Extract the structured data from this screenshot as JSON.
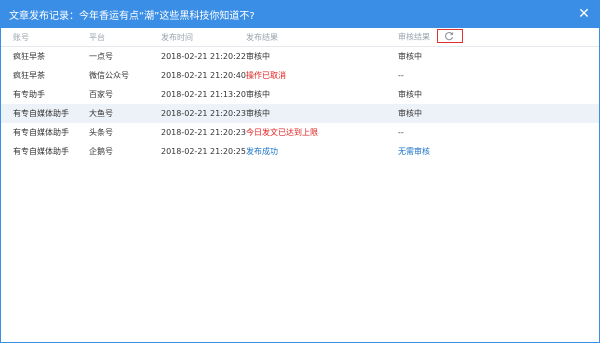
{
  "dialog": {
    "title": "文章发布记录：今年香运有点“潮”这些黑科技你知道不?"
  },
  "table": {
    "headers": [
      "账号",
      "平台",
      "发布时间",
      "发布结果",
      "审核结果"
    ],
    "rows": [
      {
        "account": "疯狂早茶",
        "platform": "一点号",
        "time": "2018-02-21 21:20:22",
        "result": "审核中",
        "review": "审核中"
      },
      {
        "account": "疯狂早茶",
        "platform": "微信公众号",
        "time": "2018-02-21 21:20:40",
        "result": "操作已取消",
        "review": "--"
      },
      {
        "account": "有专助手",
        "platform": "百家号",
        "time": "2018-02-21 21:13:20",
        "result": "审核中",
        "review": "审核中"
      },
      {
        "account": "有专自媒体助手",
        "platform": "大鱼号",
        "time": "2018-02-21 21:20:23",
        "result": "审核中",
        "review": "审核中"
      },
      {
        "account": "有专自媒体助手",
        "platform": "头条号",
        "time": "2018-02-21 21:20:23",
        "result": "今日发文已达到上限",
        "review": "--"
      },
      {
        "account": "有专自媒体助手",
        "platform": "企鹅号",
        "time": "2018-02-21 21:20:25",
        "result": "发布成功",
        "review": "无需审核"
      }
    ]
  },
  "colors": {
    "accent": "#3a8ee6",
    "error": "#e02020",
    "success": "#1a73c7",
    "highlight_row": "#edf2f8"
  },
  "icons": {
    "close": "close-icon",
    "refresh": "refresh-icon"
  }
}
